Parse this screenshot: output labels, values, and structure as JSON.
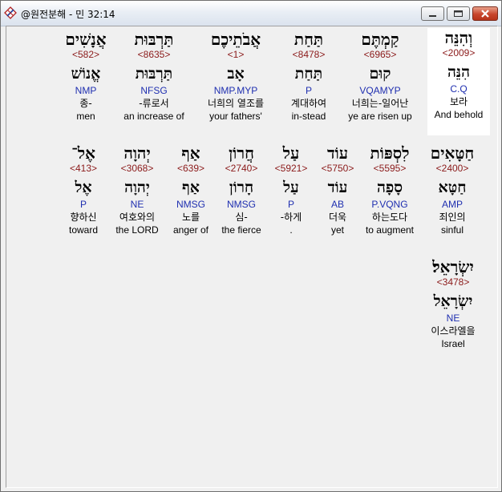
{
  "window": {
    "title": "@원전분해 - 민 32:14"
  },
  "icons": {
    "app": "bible-app-icon",
    "minimize": "minimize-icon",
    "maximize": "maximize-icon",
    "close": "close-icon"
  },
  "colors": {
    "strong_number": "#8b1a1a",
    "morphology": "#1f2fb0",
    "selected_background": "#ffffff"
  },
  "rows": [
    [
      {
        "hebrew": "וְהִנֵּה",
        "strong": "<2009>",
        "lemma": "הִנֵּה",
        "morph": "C.Q",
        "korean": "보라",
        "english": "And behold",
        "selected": true
      },
      {
        "hebrew": "קַמְתֶּם",
        "strong": "<6965>",
        "lemma": "קוּם",
        "morph": "VQAMYP",
        "korean": "너희는-일어난",
        "english": "ye are risen up"
      },
      {
        "hebrew": "תַּחַת",
        "strong": "<8478>",
        "lemma": "תַּחַת",
        "morph": "P",
        "korean": "계대하여",
        "english": "in-stead"
      },
      {
        "hebrew": "אֲבֹתֵיכֶם",
        "strong": "<1>",
        "lemma": "אָב",
        "morph": "NMP.MYP",
        "korean": "너희의 열조를",
        "english": "your fathers'"
      },
      {
        "hebrew": "תַּרְבּוּת",
        "strong": "<8635>",
        "lemma": "תַּרְבּוּת",
        "morph": "NFSG",
        "korean": "-류로서",
        "english": "an increase of"
      },
      {
        "hebrew": "אֲנָשִׁים",
        "strong": "<582>",
        "lemma": "אֱנוֹשׁ",
        "morph": "NMP",
        "korean": "종-",
        "english": "men"
      }
    ],
    [
      {
        "hebrew": "חַטָּאִים",
        "strong": "<2400>",
        "lemma": "חַטָּא",
        "morph": "AMP",
        "korean": "죄인의",
        "english": "sinful"
      },
      {
        "hebrew": "לִסְפּוֹת",
        "strong": "<5595>",
        "lemma": "סָפָה",
        "morph": "P.VQNG",
        "korean": "하는도다",
        "english": "to augment"
      },
      {
        "hebrew": "עוֹד",
        "strong": "<5750>",
        "lemma": "עוֹד",
        "morph": "AB",
        "korean": "더욱",
        "english": "yet"
      },
      {
        "hebrew": "עַל",
        "strong": "<5921>",
        "lemma": "עַל",
        "morph": "P",
        "korean": "-하게",
        "english": "."
      },
      {
        "hebrew": "חֲרוֹן",
        "strong": "<2740>",
        "lemma": "חָרוֹן",
        "morph": "NMSG",
        "korean": "심-",
        "english": "the fierce"
      },
      {
        "hebrew": "אַף",
        "strong": "<639>",
        "lemma": "אַף",
        "morph": "NMSG",
        "korean": "노를",
        "english": "anger of"
      },
      {
        "hebrew": "יְהוָה",
        "strong": "<3068>",
        "lemma": "יְהוָה",
        "morph": "NE",
        "korean": "여호와의",
        "english": "the LORD"
      },
      {
        "hebrew": "אֶל־",
        "strong": "<413>",
        "lemma": "אֶל",
        "morph": "P",
        "korean": "향하신",
        "english": "toward"
      }
    ],
    [
      {
        "hebrew": "יִשְׂרָאֵל׃",
        "strong": "<3478>",
        "lemma": "יִשְׂרָאֵל",
        "morph": "NE",
        "korean": "이스라엘을",
        "english": "Israel"
      }
    ]
  ]
}
